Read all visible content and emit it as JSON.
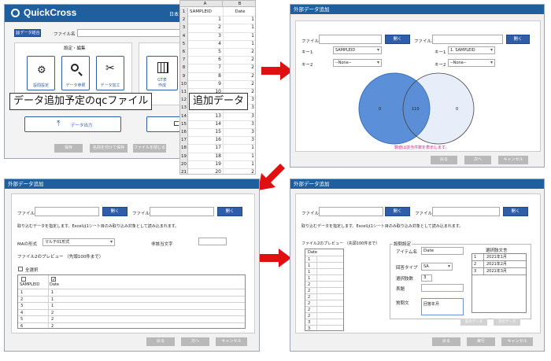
{
  "panel_main": {
    "app_title": "QuickCross",
    "corner_text": "日本",
    "data_btn": "データ結合",
    "file_label": "ファイル名",
    "section_title": "設定・編集",
    "icons": [
      {
        "icon": "gear-icon",
        "label": "設問設定"
      },
      {
        "icon": "search-icon",
        "label": "データ参照"
      },
      {
        "icon": "scissors-icon",
        "label": "データ加工"
      },
      {
        "icon": "calculator-icon",
        "label": "GT表"
      },
      {
        "icon": "calculator-icon",
        "label": "作成"
      }
    ],
    "output_btn": "データ出力",
    "bottom_buttons": [
      "保存",
      "名前を付けて保存",
      "ファイルを閉じる"
    ]
  },
  "banners": {
    "left": "データ追加予定のqcファイル",
    "right": "追加データ"
  },
  "sheet": {
    "col_a": "A",
    "col_b": "B",
    "header_a": "SAMPLEID",
    "header_b": "Date",
    "rows": [
      {
        "n": "1",
        "a": "",
        "b": ""
      },
      {
        "n": "2",
        "a": "1",
        "b": "1"
      },
      {
        "n": "3",
        "a": "2",
        "b": "1"
      },
      {
        "n": "4",
        "a": "3",
        "b": "1"
      },
      {
        "n": "5",
        "a": "4",
        "b": "1"
      },
      {
        "n": "6",
        "a": "5",
        "b": "2"
      },
      {
        "n": "7",
        "a": "6",
        "b": "2"
      },
      {
        "n": "8",
        "a": "7",
        "b": "2"
      },
      {
        "n": "9",
        "a": "8",
        "b": "2"
      },
      {
        "n": "10",
        "a": "9",
        "b": "2"
      },
      {
        "n": "11",
        "a": "10",
        "b": "2"
      },
      {
        "n": "12",
        "a": "11",
        "b": "3"
      },
      {
        "n": "13",
        "a": "12",
        "b": "3"
      },
      {
        "n": "14",
        "a": "13",
        "b": "3"
      },
      {
        "n": "15",
        "a": "14",
        "b": "3"
      },
      {
        "n": "16",
        "a": "15",
        "b": "3"
      },
      {
        "n": "17",
        "a": "16",
        "b": "3"
      },
      {
        "n": "18",
        "a": "17",
        "b": "1"
      },
      {
        "n": "19",
        "a": "18",
        "b": "1"
      },
      {
        "n": "20",
        "a": "19",
        "b": "1"
      },
      {
        "n": "21",
        "a": "20",
        "b": "2"
      }
    ]
  },
  "dialog_tr": {
    "title": "外部データ追加",
    "file1": "ファイル1",
    "file2": "ファイル2",
    "open": "開く",
    "key1": "キー1",
    "key2": "キー2",
    "key1_left_value": "SAMPLEID",
    "key1_right_value": "1. SAMPLEID",
    "key2_value": "--None--",
    "venn_left": "0",
    "venn_mid": "110",
    "venn_right": "0",
    "note": "数値は該当件数を表示します。",
    "buttons": [
      "戻る",
      "次へ",
      "キャンセル"
    ]
  },
  "dialog_bl": {
    "title": "外部データ追加",
    "file1": "ファイル1",
    "file2": "ファイル2",
    "open": "開く",
    "instruction": "取り込むデータを指定します。Excelは1シート目のみ取り込み対象として読み込まれます。",
    "ma_label": "MAの形式",
    "ma_value": "マルチ01形式",
    "nonmatch_label": "非該当文字",
    "preview_label": "ファイル2のプレビュー （先頭100件まで）",
    "select_all": "全選択",
    "col1": "SAMPLEID",
    "col2": "Date",
    "rows": [
      [
        "1",
        "1"
      ],
      [
        "2",
        "1"
      ],
      [
        "3",
        "1"
      ],
      [
        "4",
        "2"
      ],
      [
        "5",
        "2"
      ],
      [
        "6",
        "2"
      ]
    ],
    "buttons": [
      "戻る",
      "次へ",
      "キャンセル"
    ]
  },
  "dialog_br": {
    "title": "外部データ追加",
    "file1": "ファイル1",
    "file2": "ファイル2",
    "open": "開く",
    "instruction": "取り込むデータを指定します。Excelは1シート目のみ取り込み対象として読み込まれます。",
    "preview_label": "ファイル2のプレビュー （先頭100件まで）",
    "preview_col": "Date",
    "preview_rows": [
      "1",
      "1",
      "1",
      "1",
      "2",
      "2",
      "2",
      "2",
      "2",
      "2",
      "3",
      "3"
    ],
    "settings_title": "設問設定",
    "item_name_label": "アイテム名",
    "item_name_value": "Date",
    "type_label": "回答タイプ",
    "type_value": "SA",
    "count_label": "選択肢数",
    "count_value": "3",
    "heading_label": "表題",
    "question_label": "質問文",
    "question_value": "回答年月",
    "choices_title": "選択肢文言",
    "choices": [
      [
        "1",
        "2021年1月"
      ],
      [
        "2",
        "2021年2月"
      ],
      [
        "3",
        "2021年3月"
      ]
    ],
    "small_buttons": [
      "前のデータ",
      "次のデータ"
    ],
    "buttons": [
      "戻る",
      "実行",
      "キャンセル"
    ]
  }
}
